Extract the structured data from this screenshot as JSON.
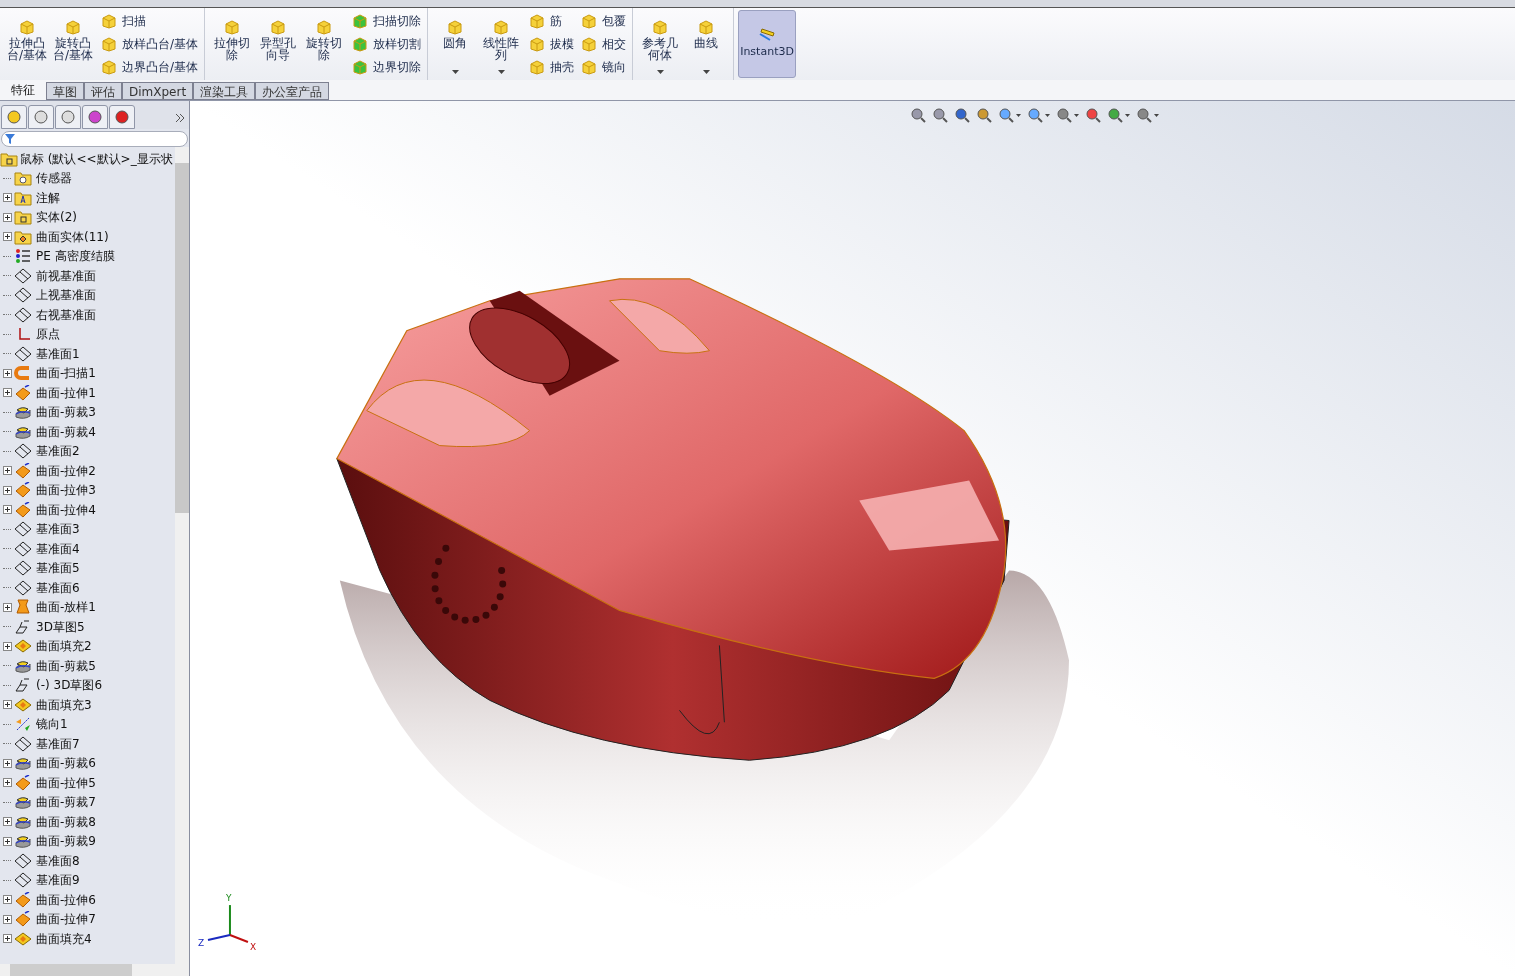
{
  "ribbon": {
    "groups": [
      {
        "large": [
          {
            "label": "拉伸凸台/基体",
            "dropdown": false
          },
          {
            "label": "旋转凸台/基体",
            "dropdown": false
          }
        ],
        "small_columns": [
          [
            "扫描",
            "放样凸台/基体",
            "边界凸台/基体"
          ]
        ]
      },
      {
        "large": [
          {
            "label": "拉伸切除",
            "dropdown": false
          },
          {
            "label": "异型孔向导",
            "dropdown": false
          },
          {
            "label": "旋转切除",
            "dropdown": false
          }
        ],
        "small_columns": [
          [
            "扫描切除",
            "放样切割",
            "边界切除"
          ]
        ]
      },
      {
        "large": [
          {
            "label": "圆角",
            "dropdown": true
          },
          {
            "label": "线性阵列",
            "dropdown": true
          }
        ],
        "small_columns": [
          [
            "筋",
            "拔模",
            "抽壳"
          ],
          [
            "包覆",
            "相交",
            "镜向"
          ]
        ]
      },
      {
        "large": [
          {
            "label": "参考几何体",
            "dropdown": true
          },
          {
            "label": "曲线",
            "dropdown": true
          }
        ]
      }
    ],
    "instant3d": {
      "label": "Instant3D",
      "on": true
    }
  },
  "tabs": [
    {
      "label": "特征",
      "selected": true
    },
    {
      "label": "草图",
      "selected": false
    },
    {
      "label": "评估",
      "selected": false
    },
    {
      "label": "DimXpert",
      "selected": false
    },
    {
      "label": "渲染工具",
      "selected": false
    },
    {
      "label": "办公室产品",
      "selected": false
    }
  ],
  "feature_tree": {
    "root": "鼠标  (默认<<默认>_显示状",
    "items": [
      {
        "kind": "sensor",
        "label": "传感器",
        "expandable": false
      },
      {
        "kind": "annotation",
        "label": "注解",
        "expandable": true
      },
      {
        "kind": "solid",
        "label": "实体(2)",
        "expandable": true
      },
      {
        "kind": "surface-body",
        "label": "曲面实体(11)",
        "expandable": true
      },
      {
        "kind": "material",
        "label": "PE 高密度结膜",
        "expandable": false
      },
      {
        "kind": "plane",
        "label": "前视基准面",
        "expandable": false
      },
      {
        "kind": "plane",
        "label": "上视基准面",
        "expandable": false
      },
      {
        "kind": "plane",
        "label": "右视基准面",
        "expandable": false
      },
      {
        "kind": "origin",
        "label": "原点",
        "expandable": false
      },
      {
        "kind": "plane",
        "label": "基准面1",
        "expandable": false
      },
      {
        "kind": "sweep",
        "label": "曲面-扫描1",
        "expandable": true
      },
      {
        "kind": "extrude",
        "label": "曲面-拉伸1",
        "expandable": true
      },
      {
        "kind": "trim",
        "label": "曲面-剪裁3",
        "expandable": false
      },
      {
        "kind": "trim",
        "label": "曲面-剪裁4",
        "expandable": false
      },
      {
        "kind": "plane",
        "label": "基准面2",
        "expandable": false
      },
      {
        "kind": "extrude",
        "label": "曲面-拉伸2",
        "expandable": true
      },
      {
        "kind": "extrude",
        "label": "曲面-拉伸3",
        "expandable": true
      },
      {
        "kind": "extrude",
        "label": "曲面-拉伸4",
        "expandable": true
      },
      {
        "kind": "plane",
        "label": "基准面3",
        "expandable": false
      },
      {
        "kind": "plane",
        "label": "基准面4",
        "expandable": false
      },
      {
        "kind": "plane",
        "label": "基准面5",
        "expandable": false
      },
      {
        "kind": "plane",
        "label": "基准面6",
        "expandable": false
      },
      {
        "kind": "loft",
        "label": "曲面-放样1",
        "expandable": true
      },
      {
        "kind": "sketch3d",
        "label": "3D草图5",
        "expandable": false
      },
      {
        "kind": "fill",
        "label": "曲面填充2",
        "expandable": true
      },
      {
        "kind": "trim",
        "label": "曲面-剪裁5",
        "expandable": false
      },
      {
        "kind": "sketch3d",
        "label": "(-) 3D草图6",
        "expandable": false
      },
      {
        "kind": "fill",
        "label": "曲面填充3",
        "expandable": true
      },
      {
        "kind": "mirror",
        "label": "镜向1",
        "expandable": false
      },
      {
        "kind": "plane",
        "label": "基准面7",
        "expandable": false
      },
      {
        "kind": "trim",
        "label": "曲面-剪裁6",
        "expandable": true
      },
      {
        "kind": "extrude",
        "label": "曲面-拉伸5",
        "expandable": true
      },
      {
        "kind": "trim",
        "label": "曲面-剪裁7",
        "expandable": false
      },
      {
        "kind": "trim",
        "label": "曲面-剪裁8",
        "expandable": true
      },
      {
        "kind": "trim",
        "label": "曲面-剪裁9",
        "expandable": true
      },
      {
        "kind": "plane",
        "label": "基准面8",
        "expandable": false
      },
      {
        "kind": "plane",
        "label": "基准面9",
        "expandable": false
      },
      {
        "kind": "extrude",
        "label": "曲面-拉伸6",
        "expandable": true
      },
      {
        "kind": "extrude",
        "label": "曲面-拉伸7",
        "expandable": true
      },
      {
        "kind": "fill",
        "label": "曲面填充4",
        "expandable": true
      }
    ]
  },
  "triad": {
    "x": "X",
    "y": "Y",
    "z": "Z"
  }
}
